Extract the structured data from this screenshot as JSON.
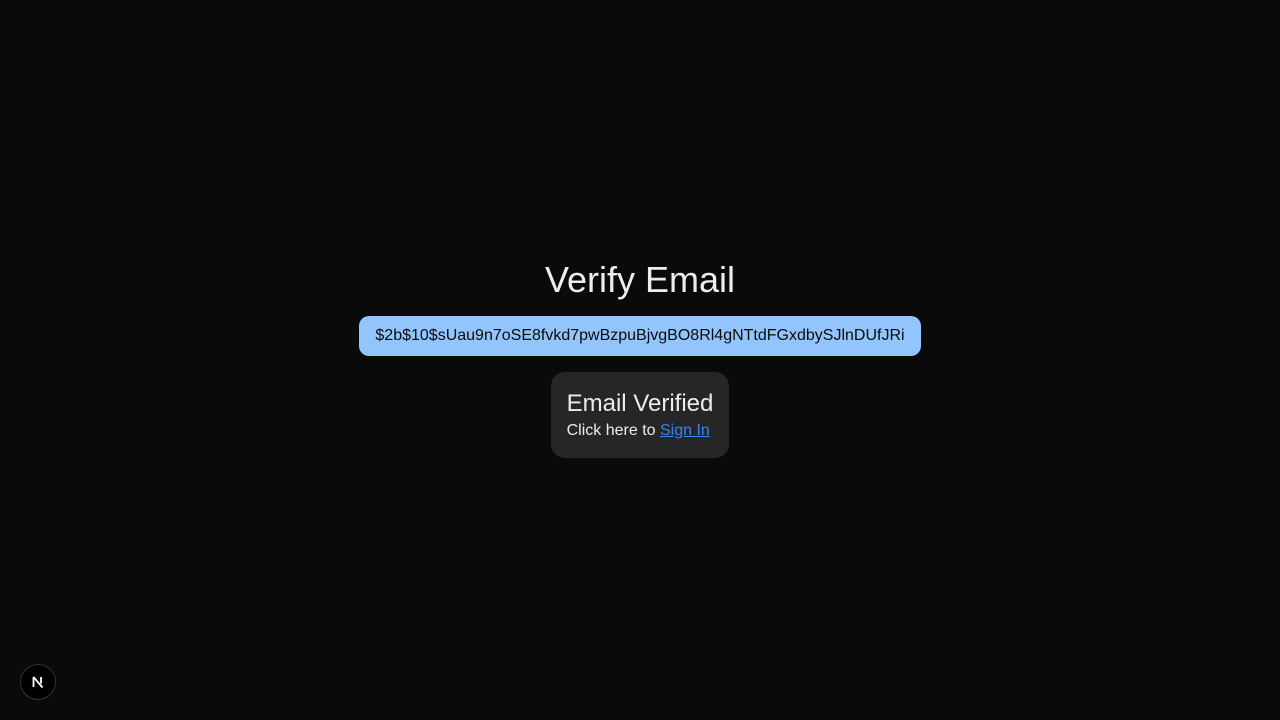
{
  "page": {
    "title": "Verify Email",
    "token": "$2b$10$sUau9n7oSE8fvkd7pwBzpuBjvgBO8Rl4gNTtdFGxdbySJlnDUfJRi"
  },
  "status_card": {
    "heading": "Email Verified",
    "prefix_text": "Click here to ",
    "link_label": "Sign In"
  },
  "dev_badge": {
    "icon": "nextjs-logo-icon"
  },
  "colors": {
    "background": "#0a0a0a",
    "token_bg": "#93c5fd",
    "card_bg": "#262626",
    "link": "#3b82f6"
  }
}
